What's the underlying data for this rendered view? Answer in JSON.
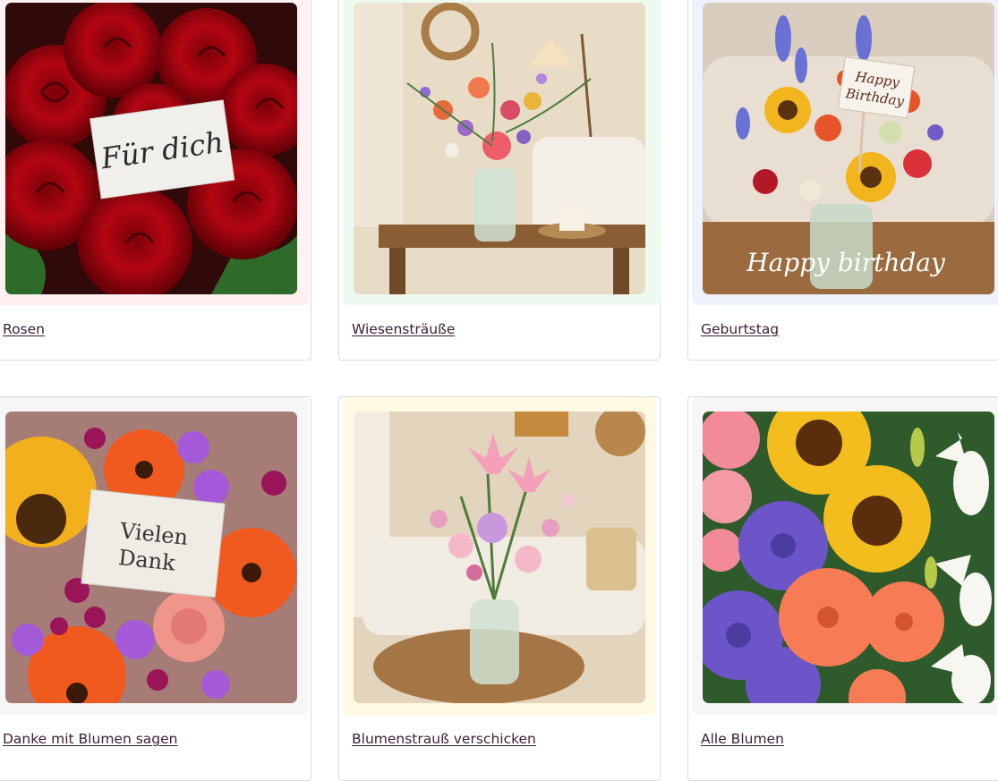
{
  "cards": [
    {
      "label": "Rosen",
      "image_alt": "Rote Rosen mit Karte",
      "card_text": "Für dich",
      "tint": "#fff0f2"
    },
    {
      "label": "Wiesensträuße",
      "image_alt": "Wiesenstrauß in Glasvase",
      "tint": "#eefaef"
    },
    {
      "label": "Geburtstag",
      "image_alt": "Geburtstagsstrauß mit Sonnenblumen",
      "card_text_line1": "Happy",
      "card_text_line2": "Birthday",
      "overlay_text": "Happy birthday",
      "tint": "#eef3fb"
    },
    {
      "label": "Danke mit Blumen sagen",
      "image_alt": "Dankesstrauß mit Gerbera",
      "card_text_line1": "Vielen",
      "card_text_line2": "Dank",
      "tint": "#f6f6f6"
    },
    {
      "label": "Blumenstrauß verschicken",
      "image_alt": "Blumenstrauß mit Lilien auf Tisch",
      "tint": "#fff8e2"
    },
    {
      "label": "Alle Blumen",
      "image_alt": "Sonnenblumen, Dahlien, Gerbera und Lilien",
      "tint": "#f6f6f6"
    }
  ]
}
